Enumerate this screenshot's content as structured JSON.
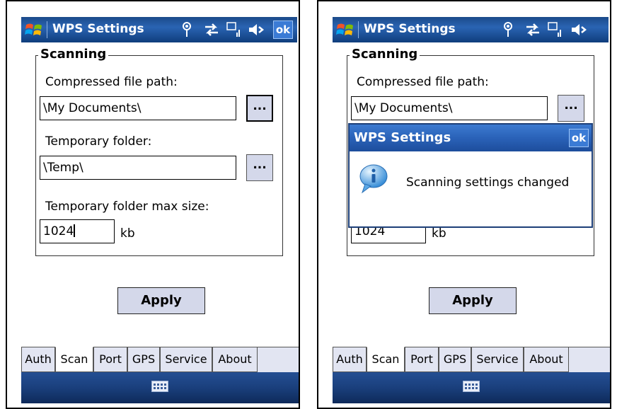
{
  "screens": [
    {
      "title": "WPS Settings",
      "status_icons": [
        "antenna-icon",
        "data-transfer-icon",
        "3g-signal-icon",
        "speaker-icon"
      ],
      "ok_label": "ok",
      "group_label": "Scanning",
      "compressed_path_label": "Compressed file path:",
      "compressed_path_value": "\\My Documents\\",
      "browse_label": "...",
      "temp_folder_label": "Temporary folder:",
      "temp_folder_value": "\\Temp\\",
      "max_size_label": "Temporary folder max size:",
      "max_size_value": "1024",
      "max_size_unit": "kb",
      "apply_label": "Apply",
      "tabs": [
        "Auth",
        "Scan",
        "Port",
        "GPS",
        "Service",
        "About"
      ],
      "active_tab": "Scan"
    },
    {
      "title": "WPS Settings",
      "status_icons": [
        "antenna-icon",
        "data-transfer-icon",
        "3g-signal-icon",
        "speaker-icon"
      ],
      "group_label": "Scanning",
      "compressed_path_label": "Compressed file path:",
      "compressed_path_value": "\\My Documents\\",
      "browse_label": "...",
      "max_size_value": "1024",
      "max_size_unit": "kb",
      "apply_label": "Apply",
      "tabs": [
        "Auth",
        "Scan",
        "Port",
        "GPS",
        "Service",
        "About"
      ],
      "active_tab": "Scan",
      "dialog": {
        "title": "WPS Settings",
        "ok_label": "ok",
        "message": "Scanning settings changed",
        "icon": "info-icon"
      }
    }
  ],
  "colors": {
    "titlebar": "#1b4a8a",
    "button_face": "#d4d8ea",
    "tab_face": "#e2e5f2",
    "ok_button": "#3b7bd5"
  }
}
